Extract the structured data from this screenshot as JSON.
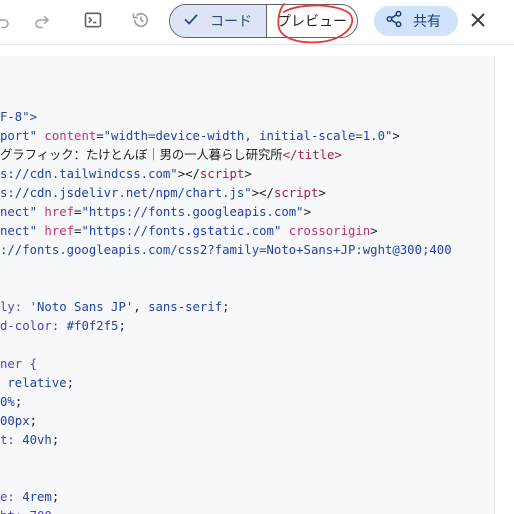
{
  "toolbar": {
    "code_label": "コード",
    "preview_label": "プレビュー",
    "share_label": "共有"
  },
  "icons": {
    "undo": "undo-icon",
    "redo": "redo-icon",
    "terminal": "terminal-icon",
    "history": "history-icon",
    "check": "check-icon",
    "share": "share-icon",
    "close": "close-icon"
  },
  "colors": {
    "tag": "#a4204a",
    "attr": "#c0307a",
    "string": "#2442a8",
    "text": "#202124",
    "keyword": "#5a3fb8",
    "annotation": "#e53935",
    "segment_active": "#dce4f5",
    "share_bg": "#cfe3fb"
  },
  "code_lines": [
    [
      {
        "t": "F-8\">",
        "c": "string"
      }
    ],
    [
      {
        "t": "port\" ",
        "c": "string"
      },
      {
        "t": "content",
        "c": "attr"
      },
      {
        "t": "=",
        "c": "text"
      },
      {
        "t": "\"width=device-width, initial-scale=1.0\"",
        "c": "string"
      },
      {
        "t": ">",
        "c": "text"
      }
    ],
    [
      {
        "t": "グラフィック：たけとんぼ｜男の一人暮らし研究所",
        "c": "text"
      },
      {
        "t": "</title>",
        "c": "tag"
      }
    ],
    [
      {
        "t": "s://cdn.tailwindcss.com\"",
        "c": "string"
      },
      {
        "t": "></",
        "c": "text"
      },
      {
        "t": "script",
        "c": "tag"
      },
      {
        "t": ">",
        "c": "text"
      }
    ],
    [
      {
        "t": "s://cdn.jsdelivr.net/npm/chart.js\"",
        "c": "string"
      },
      {
        "t": "></",
        "c": "text"
      },
      {
        "t": "script",
        "c": "tag"
      },
      {
        "t": ">",
        "c": "text"
      }
    ],
    [
      {
        "t": "nect\" ",
        "c": "string"
      },
      {
        "t": "href",
        "c": "attr"
      },
      {
        "t": "=",
        "c": "text"
      },
      {
        "t": "\"https://fonts.googleapis.com\"",
        "c": "string"
      },
      {
        "t": ">",
        "c": "text"
      }
    ],
    [
      {
        "t": "nect\" ",
        "c": "string"
      },
      {
        "t": "href",
        "c": "attr"
      },
      {
        "t": "=",
        "c": "text"
      },
      {
        "t": "\"https://fonts.gstatic.com\" ",
        "c": "string"
      },
      {
        "t": "crossorigin",
        "c": "attr"
      },
      {
        "t": ">",
        "c": "text"
      }
    ],
    [
      {
        "t": "://fonts.googleapis.com/css2?family=Noto+Sans+JP:wght@300;400",
        "c": "string"
      }
    ],
    [],
    [],
    [
      {
        "t": "ly: ",
        "c": "keyword"
      },
      {
        "t": "'Noto Sans JP'",
        "c": "string"
      },
      {
        "t": ", ",
        "c": "text"
      },
      {
        "t": "sans-serif",
        "c": "string"
      },
      {
        "t": ";",
        "c": "text"
      }
    ],
    [
      {
        "t": "d-color: ",
        "c": "keyword"
      },
      {
        "t": "#f0f2f5",
        "c": "string"
      },
      {
        "t": ";",
        "c": "text"
      }
    ],
    [],
    [
      {
        "t": "ner {",
        "c": "keyword"
      }
    ],
    [
      {
        "t": " relative",
        "c": "string"
      },
      {
        "t": ";",
        "c": "text"
      }
    ],
    [
      {
        "t": "0%",
        "c": "string"
      },
      {
        "t": ";",
        "c": "text"
      }
    ],
    [
      {
        "t": "00px",
        "c": "string"
      },
      {
        "t": ";",
        "c": "text"
      }
    ],
    [
      {
        "t": "t: ",
        "c": "keyword"
      },
      {
        "t": "40vh",
        "c": "string"
      },
      {
        "t": ";",
        "c": "text"
      }
    ],
    [],
    [],
    [
      {
        "t": "e: ",
        "c": "keyword"
      },
      {
        "t": "4rem",
        "c": "string"
      },
      {
        "t": ";",
        "c": "text"
      }
    ],
    [
      {
        "t": "ht: 700",
        "c": "keyword"
      }
    ]
  ]
}
